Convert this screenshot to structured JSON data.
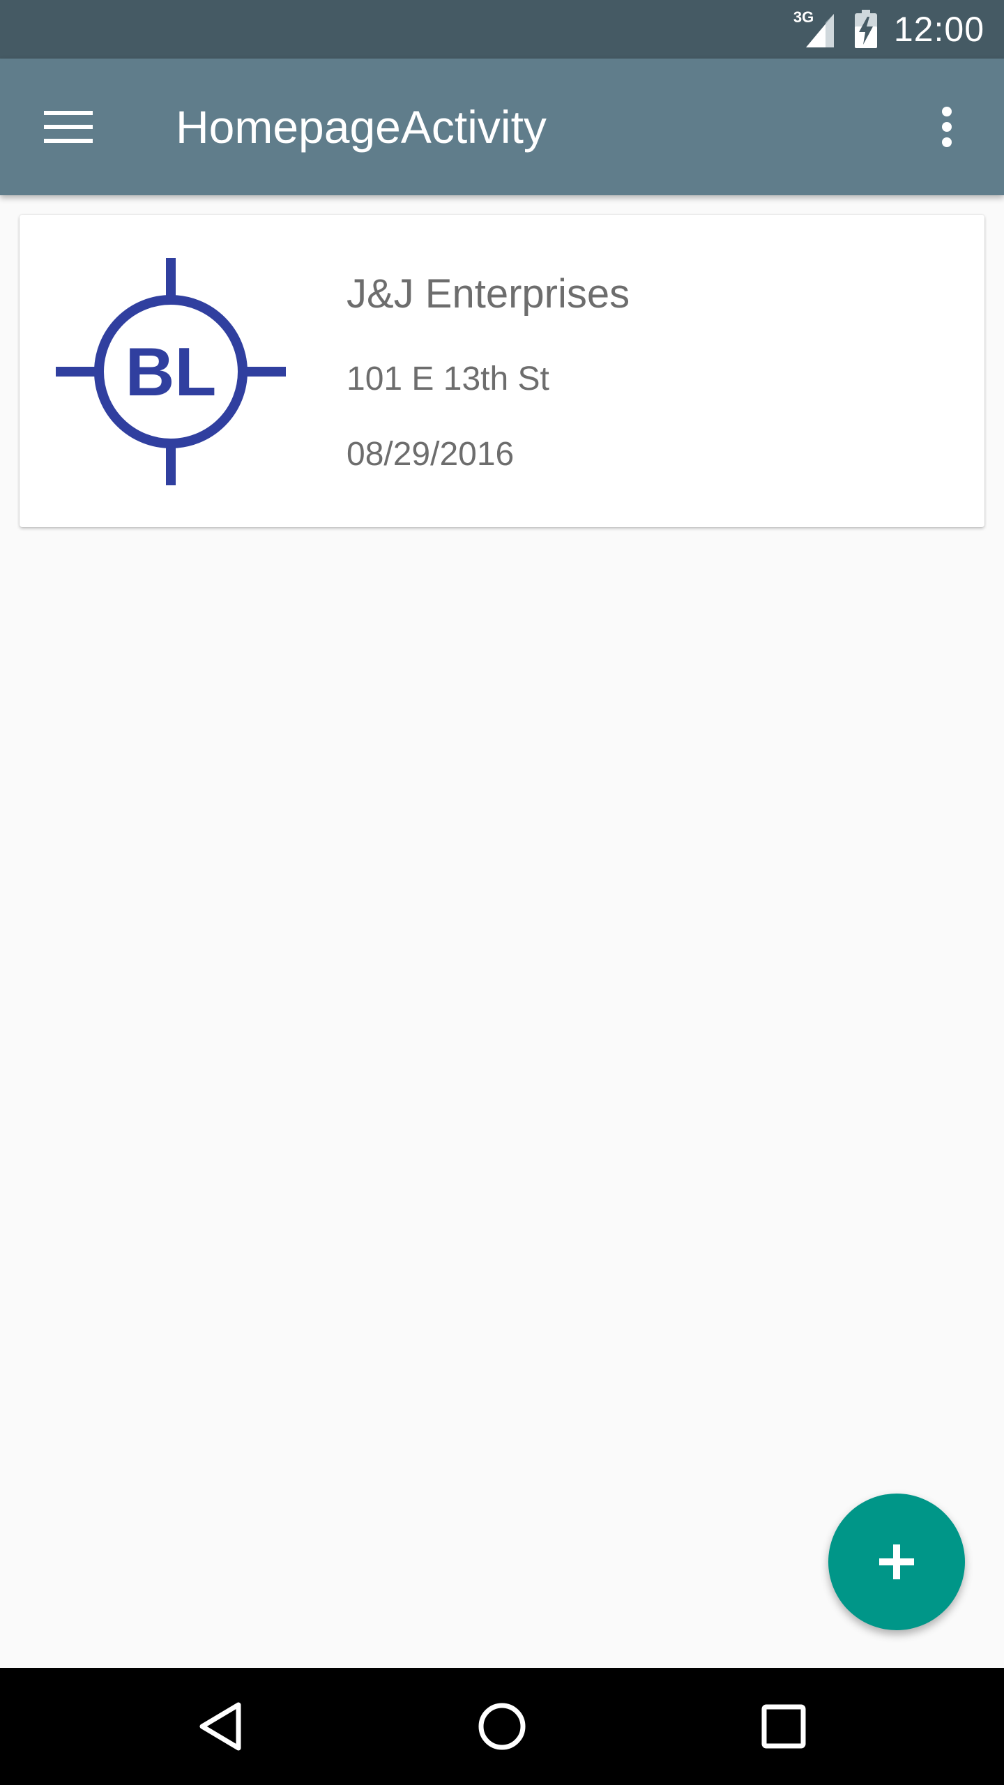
{
  "status_bar": {
    "network": "3G",
    "time": "12:00"
  },
  "app_bar": {
    "title": "HomepageActivity"
  },
  "cards": [
    {
      "logo_text": "BL",
      "name": "J&J Enterprises",
      "address": "101 E 13th St",
      "date": "08/29/2016"
    }
  ],
  "icons": {
    "menu": "menu-icon",
    "overflow": "more-vert-icon",
    "fab": "add-icon",
    "back": "back-icon",
    "home": "home-icon",
    "recents": "recents-icon",
    "signal": "signal-icon",
    "battery": "battery-charging-icon"
  },
  "colors": {
    "status_bar": "#455a64",
    "app_bar": "#607d8b",
    "fab": "#009688",
    "logo": "#303f9f"
  }
}
